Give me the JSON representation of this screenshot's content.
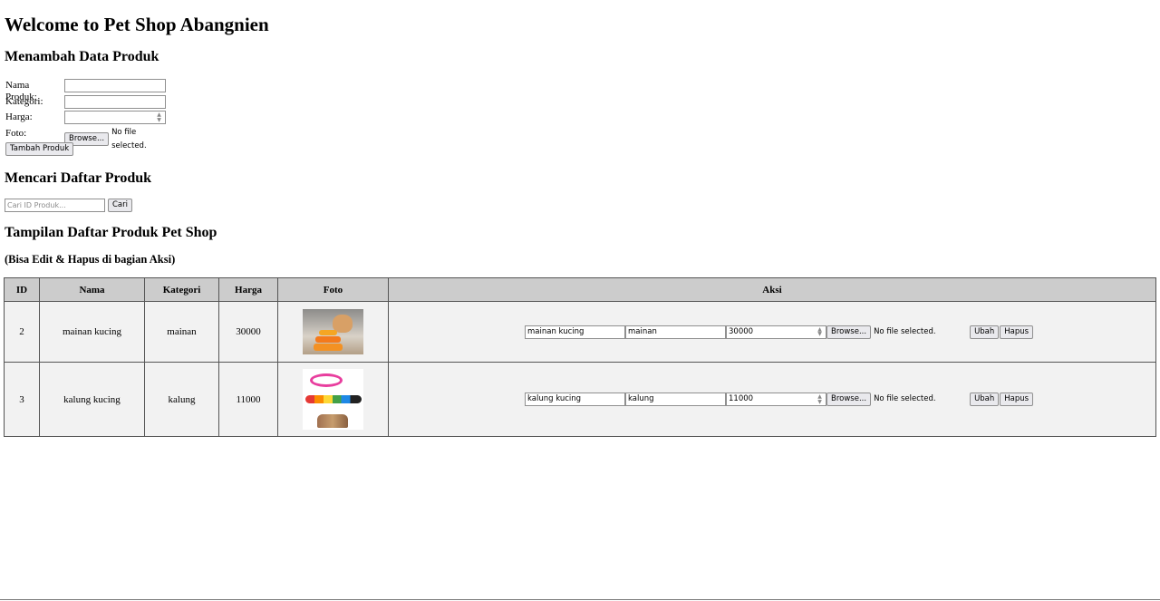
{
  "title": "Welcome to Pet Shop Abangnien",
  "add_section": {
    "heading": "Menambah Data Produk",
    "fields": {
      "name_label": "Nama Produk:",
      "name_value": "",
      "category_label": "Kategori:",
      "category_value": "",
      "price_label": "Harga:",
      "price_value": "",
      "photo_label": "Foto:",
      "browse_label": "Browse...",
      "no_file": "No file selected."
    },
    "submit_label": "Tambah Produk"
  },
  "search_section": {
    "heading": "Mencari Daftar Produk",
    "placeholder": "Cari ID Produk...",
    "button_label": "Cari"
  },
  "list_section": {
    "heading": "Tampilan Daftar Produk Pet Shop",
    "note": "(Bisa Edit & Hapus di bagian Aksi)",
    "columns": [
      "ID",
      "Nama",
      "Kategori",
      "Harga",
      "Foto",
      "Aksi"
    ],
    "rows": [
      {
        "id": "2",
        "name": "mainan kucing",
        "category": "mainan",
        "price": "30000",
        "photo_icon": "cat-toy-photo",
        "edit": {
          "name": "mainan kucing",
          "category": "mainan",
          "price": "30000",
          "browse_label": "Browse...",
          "no_file": "No file selected.",
          "update_label": "Ubah",
          "delete_label": "Hapus"
        }
      },
      {
        "id": "3",
        "name": "kalung kucing",
        "category": "kalung",
        "price": "11000",
        "photo_icon": "cat-collar-photo",
        "edit": {
          "name": "kalung kucing",
          "category": "kalung",
          "price": "11000",
          "browse_label": "Browse...",
          "no_file": "No file selected.",
          "update_label": "Ubah",
          "delete_label": "Hapus"
        }
      }
    ]
  },
  "colors": {
    "header_bg": "#cccccc",
    "row_bg": "#f2f2f2",
    "button_bg": "#e9e9ed"
  }
}
